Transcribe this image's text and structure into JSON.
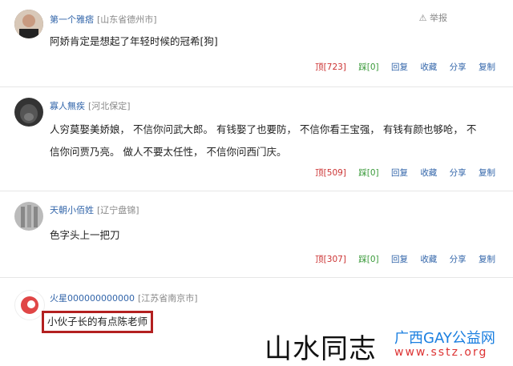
{
  "comments": [
    {
      "user": "第一个雅痞",
      "location": "[山东省德州市]",
      "text": "阿娇肯定是想起了年轻时候的冠希[狗]",
      "report": "举报",
      "up": "顶[723]",
      "down": "踩[0]",
      "reply": "回复",
      "collect": "收藏",
      "share": "分享",
      "copy": "复制"
    },
    {
      "user": "寡人無疾",
      "location": "[河北保定]",
      "text1": "人穷莫娶美娇娘， 不信你问武大郎。 有钱娶了也要防， 不信你看王宝强， 有钱有颜也够呛， 不",
      "text2": "信你问贾乃亮。 做人不要太任性， 不信你问西门庆。",
      "up": "顶[509]",
      "down": "踩[0]",
      "reply": "回复",
      "collect": "收藏",
      "share": "分享",
      "copy": "复制"
    },
    {
      "user": "天朝小佰姓",
      "location": "[辽宁盘锦]",
      "text": "色字头上一把刀",
      "up": "顶[307]",
      "down": "踩[0]",
      "reply": "回复",
      "collect": "收藏",
      "share": "分享",
      "copy": "复制"
    },
    {
      "user": "火星000000000000",
      "location": "[江苏省南京市]",
      "text": "小伙子长的有点陈老师"
    }
  ],
  "watermark": {
    "main": "山水同志",
    "site": "广西GAY公益网",
    "url": "www.sstz.org"
  },
  "icons": [
    "warning-icon"
  ],
  "colors": {
    "link": "#3366aa",
    "count": "#cc3333",
    "zero": "#3a9a3a",
    "highlight": "#b32020"
  }
}
